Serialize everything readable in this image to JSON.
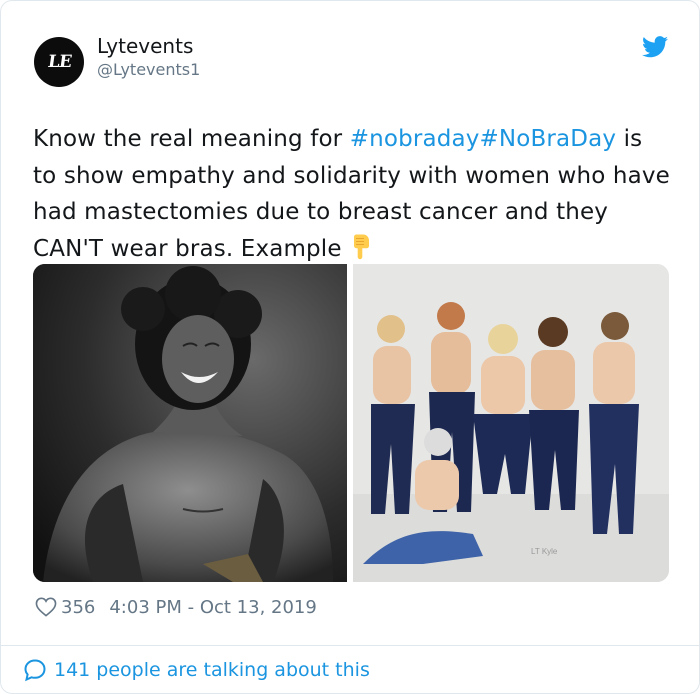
{
  "tweet": {
    "author_name": "Lytevents",
    "author_handle": "@Lytevents1",
    "avatar_text": "LE",
    "text_part1": "Know the real meaning for ",
    "hashtag1": "#nobraday",
    "hashtag2": "#NoBraDay",
    "text_part2": " is to show empathy and solidarity with women who have had mastectomies due to breast cancer and they CAN'T wear bras. Example",
    "emoji": "backhand-index-pointing-down",
    "likes": "356",
    "timestamp": "4:03 PM - Oct 13, 2019",
    "conversation": "141 people are talking about this",
    "photo_watermark": "LT Kyle"
  },
  "colors": {
    "accent": "#1b95e0",
    "text": "#14171a",
    "secondary": "#657786",
    "border": "#e1e8ed"
  },
  "icons": {
    "brand": "twitter-bird-icon",
    "like": "heart-icon",
    "reply": "speech-bubble-icon"
  }
}
